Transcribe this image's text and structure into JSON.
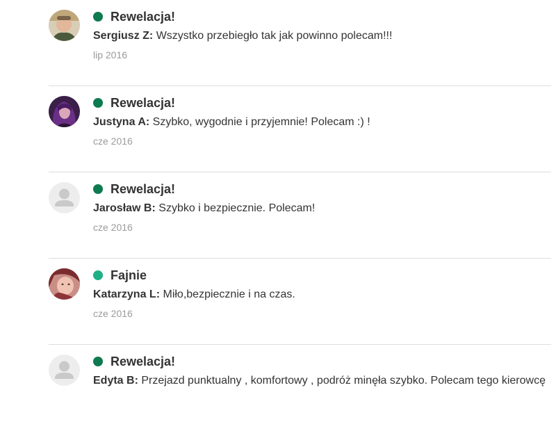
{
  "colors": {
    "rating_excellent": "#0e7a4f",
    "rating_good": "#1eb086",
    "divider": "#dddddd",
    "date_text": "#9a9a9a"
  },
  "reviews": [
    {
      "rating": "Rewelacja!",
      "rating_color": "#0e7a4f",
      "author": "Sergiusz Z:",
      "text": "Wszystko przebiegło tak jak powinno polecam!!!",
      "date": "lip 2016",
      "avatar": "user-photo-avatar"
    },
    {
      "rating": "Rewelacja!",
      "rating_color": "#0e7a4f",
      "author": "Justyna A:",
      "text": "Szybko, wygodnie i przyjemnie! Polecam :) !",
      "date": "cze 2016",
      "avatar": "user-photo-avatar"
    },
    {
      "rating": "Rewelacja!",
      "rating_color": "#0e7a4f",
      "author": "Jarosław B:",
      "text": "Szybko i bezpiecznie. Polecam!",
      "date": "cze 2016",
      "avatar": "default-user-icon"
    },
    {
      "rating": "Fajnie",
      "rating_color": "#1eb086",
      "author": "Katarzyna L:",
      "text": "Miło,bezpiecznie i na czas.",
      "date": "cze 2016",
      "avatar": "user-photo-avatar"
    },
    {
      "rating": "Rewelacja!",
      "rating_color": "#0e7a4f",
      "author": "Edyta B:",
      "text": "Przejazd punktualny , komfortowy , podróż minęła szybko. Polecam tego kierowcę",
      "date": "",
      "avatar": "default-user-icon"
    }
  ]
}
